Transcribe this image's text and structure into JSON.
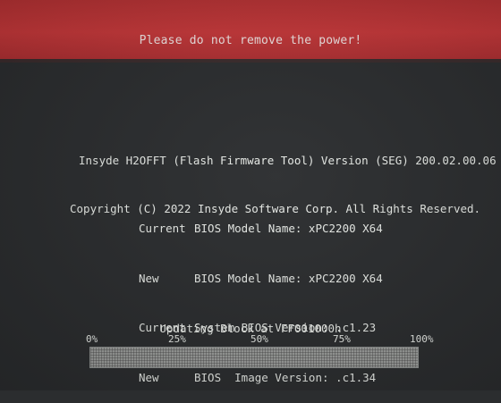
{
  "banner": {
    "message": "Please do not remove the power!",
    "color": "#c8383a"
  },
  "header": {
    "line1": "Insyde H2OFFT (Flash Firmware Tool) Version (SEG) 200.02.00.06",
    "line2": "Copyright (C) 2022 Insyde Software Corp. All Rights Reserved."
  },
  "bios_info": [
    {
      "prefix": "Current",
      "text": "BIOS Model Name: xPC2200 X64"
    },
    {
      "prefix": "New",
      "text": "BIOS Model Name: xPC2200 X64"
    },
    {
      "prefix": "Current",
      "text": "System BIOS Version: .c1.23"
    },
    {
      "prefix": "New",
      "text": "BIOS  Image Version: .c1.34"
    }
  ],
  "progress": {
    "status": "Updating Block at FF001000h",
    "fraction": 1.0,
    "ticks": [
      "0%",
      "25%",
      "50%",
      "75%",
      "100%"
    ]
  }
}
